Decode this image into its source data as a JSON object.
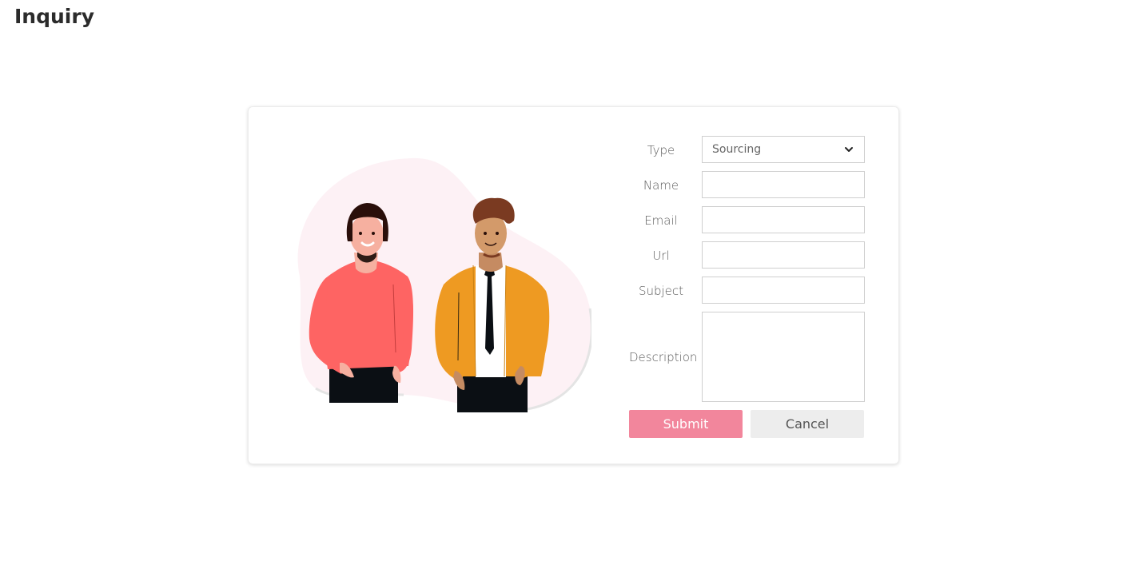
{
  "page": {
    "title": "Inquiry"
  },
  "form": {
    "type": {
      "label": "Type",
      "value": "Sourcing",
      "icon": "chevron-down-icon"
    },
    "name": {
      "label": "Name",
      "value": ""
    },
    "email": {
      "label": "Email",
      "value": ""
    },
    "url": {
      "label": "Url",
      "value": ""
    },
    "subject": {
      "label": "Subject",
      "value": ""
    },
    "description": {
      "label": "Description",
      "value": ""
    },
    "submit_label": "Submit",
    "cancel_label": "Cancel"
  },
  "colors": {
    "submit_bg": "#f2869c",
    "cancel_bg": "#ededed",
    "blob": "#fdf1f5",
    "woman_shirt": "#fe6463",
    "man_jacket": "#ee9a22"
  }
}
